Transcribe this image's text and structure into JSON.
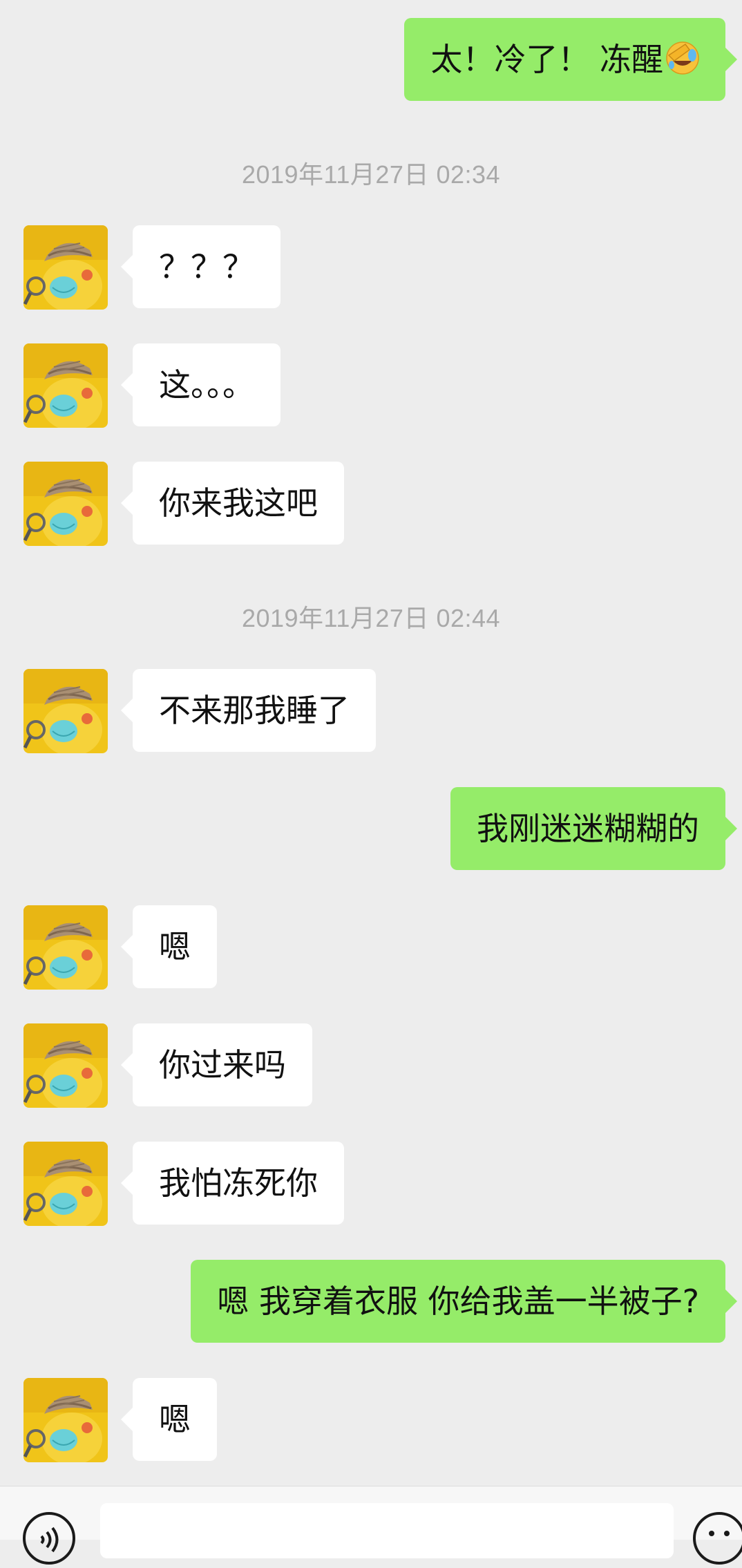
{
  "messages": [
    {
      "side": "out",
      "text": "太！冷了！  冻醒",
      "emoji": "facepalm-laughing-emoji"
    },
    {
      "timestamp": "2019年11月27日 02:34"
    },
    {
      "side": "in",
      "text": "？？？"
    },
    {
      "side": "in",
      "text": "这。。。"
    },
    {
      "side": "in",
      "text": "你来我这吧"
    },
    {
      "timestamp": "2019年11月27日 02:44"
    },
    {
      "side": "in",
      "text": "不来那我睡了"
    },
    {
      "side": "out",
      "text": "我刚迷迷糊糊的"
    },
    {
      "side": "in",
      "text": "嗯"
    },
    {
      "side": "in",
      "text": "你过来吗"
    },
    {
      "side": "in",
      "text": "我怕冻死你"
    },
    {
      "side": "out",
      "text": "嗯  我穿着衣服 你给我盖一半被子?"
    },
    {
      "side": "in",
      "text": "嗯"
    }
  ],
  "colors": {
    "background": "#ededed",
    "incoming_bubble": "#ffffff",
    "outgoing_bubble": "#95ec69",
    "timestamp_text": "#a9a9a9"
  },
  "input_bar": {
    "left_icon": "voice-icon",
    "right_icon": "emoji-face-icon"
  }
}
